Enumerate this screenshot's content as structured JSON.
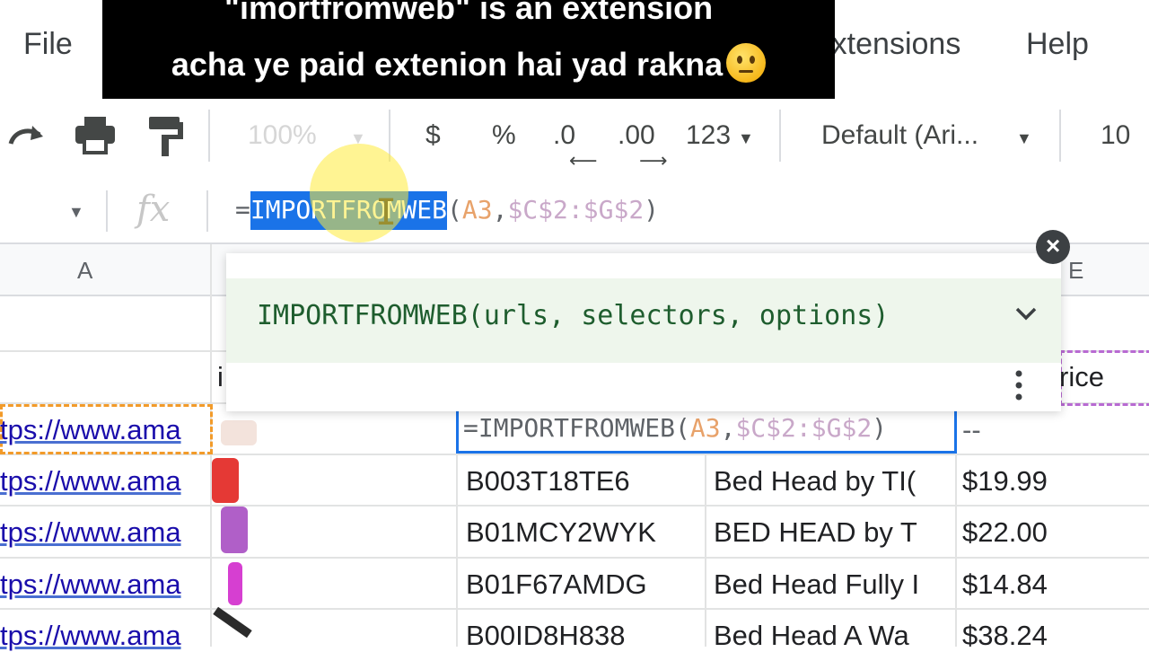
{
  "caption": {
    "line1": "\"imortfromweb\" is an extension",
    "line2": "acha ye paid extenion hai yad rakna"
  },
  "menu": {
    "file": "File",
    "extensions": "Extensions",
    "help": "Help"
  },
  "toolbar": {
    "zoom": "100%",
    "currency": "$",
    "percent": "%",
    "decrease_decimal": ".0",
    "increase_decimal": ".00",
    "number_format": "123",
    "font": "Default (Ari...",
    "font_size": "10"
  },
  "formula_bar": {
    "prefix": "=",
    "function_name": "IMPORTFROMWEB",
    "open_paren": "(",
    "arg1": "A3",
    "comma": ",",
    "arg2": "$C$2:$G$2",
    "close_paren": ")"
  },
  "autocomplete": {
    "signature": "IMPORTFROMWEB(urls, selectors, options)"
  },
  "columns": {
    "a": "A",
    "e": "E"
  },
  "row2": {
    "b_partial": "i",
    "e_partial": "rice"
  },
  "active_cell": {
    "prefix": "=IMPORTFROMWEB(",
    "arg1": "A3",
    "comma": ",",
    "arg2": "$C$2:$G$2",
    "close": ")",
    "next_cell": "--"
  },
  "rows": [
    {
      "url": "tps://www.ama",
      "asin": "",
      "title": "",
      "price": ""
    },
    {
      "url": "tps://www.ama",
      "asin": "B003T18TE6",
      "title": "Bed Head by TI(",
      "price": "$19.99"
    },
    {
      "url": "tps://www.ama",
      "asin": "B01MCY2WYK",
      "title": "BED HEAD by T",
      "price": "$22.00"
    },
    {
      "url": "tps://www.ama",
      "asin": "B01F67AMDG",
      "title": "Bed Head Fully I",
      "price": "$14.84"
    },
    {
      "url": "tps://www.ama",
      "asin": "B00ID8H838",
      "title": "Bed Head A Wa",
      "price": "$38.24"
    }
  ],
  "colors": {
    "selection": "#1a73e8",
    "autocomplete_bg": "#eef6ec",
    "link": "#1a0dab",
    "dashed_orange": "#f29b2a",
    "dashed_purple": "#b86ad2"
  }
}
